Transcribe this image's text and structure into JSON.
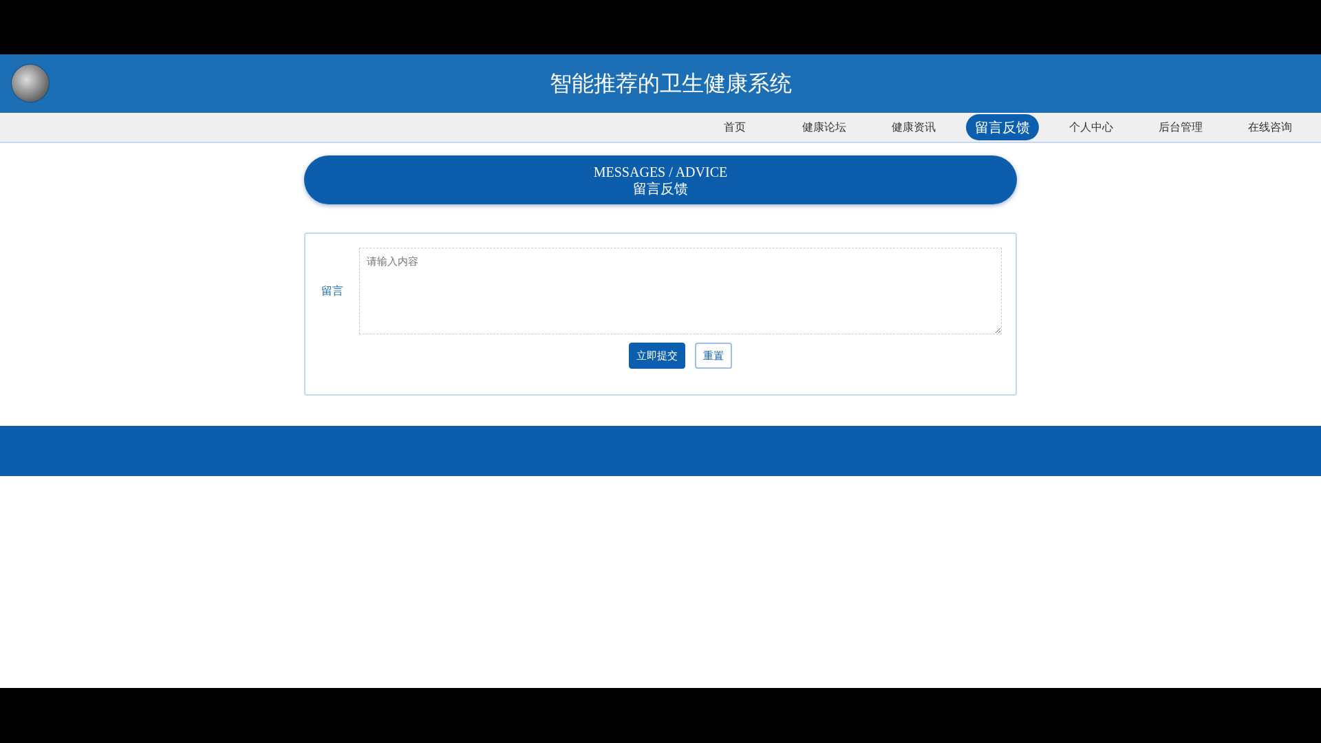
{
  "header": {
    "title": "智能推荐的卫生健康系统"
  },
  "nav": [
    {
      "label": "首页",
      "selected": false
    },
    {
      "label": "健康论坛",
      "selected": false
    },
    {
      "label": "健康资讯",
      "selected": false
    },
    {
      "label": "留言反馈",
      "selected": true
    },
    {
      "label": "个人中心",
      "selected": false
    },
    {
      "label": "后台管理",
      "selected": false
    },
    {
      "label": "在线咨询",
      "selected": false
    }
  ],
  "banner": {
    "title_en": "MESSAGES / ADVICE",
    "title_cn": "留言反馈"
  },
  "form": {
    "label": "留言",
    "placeholder": "请输入内容",
    "buttons": [
      {
        "label": "立即提交",
        "kind": "primary"
      },
      {
        "label": "重置",
        "kind": "secondary"
      }
    ]
  }
}
